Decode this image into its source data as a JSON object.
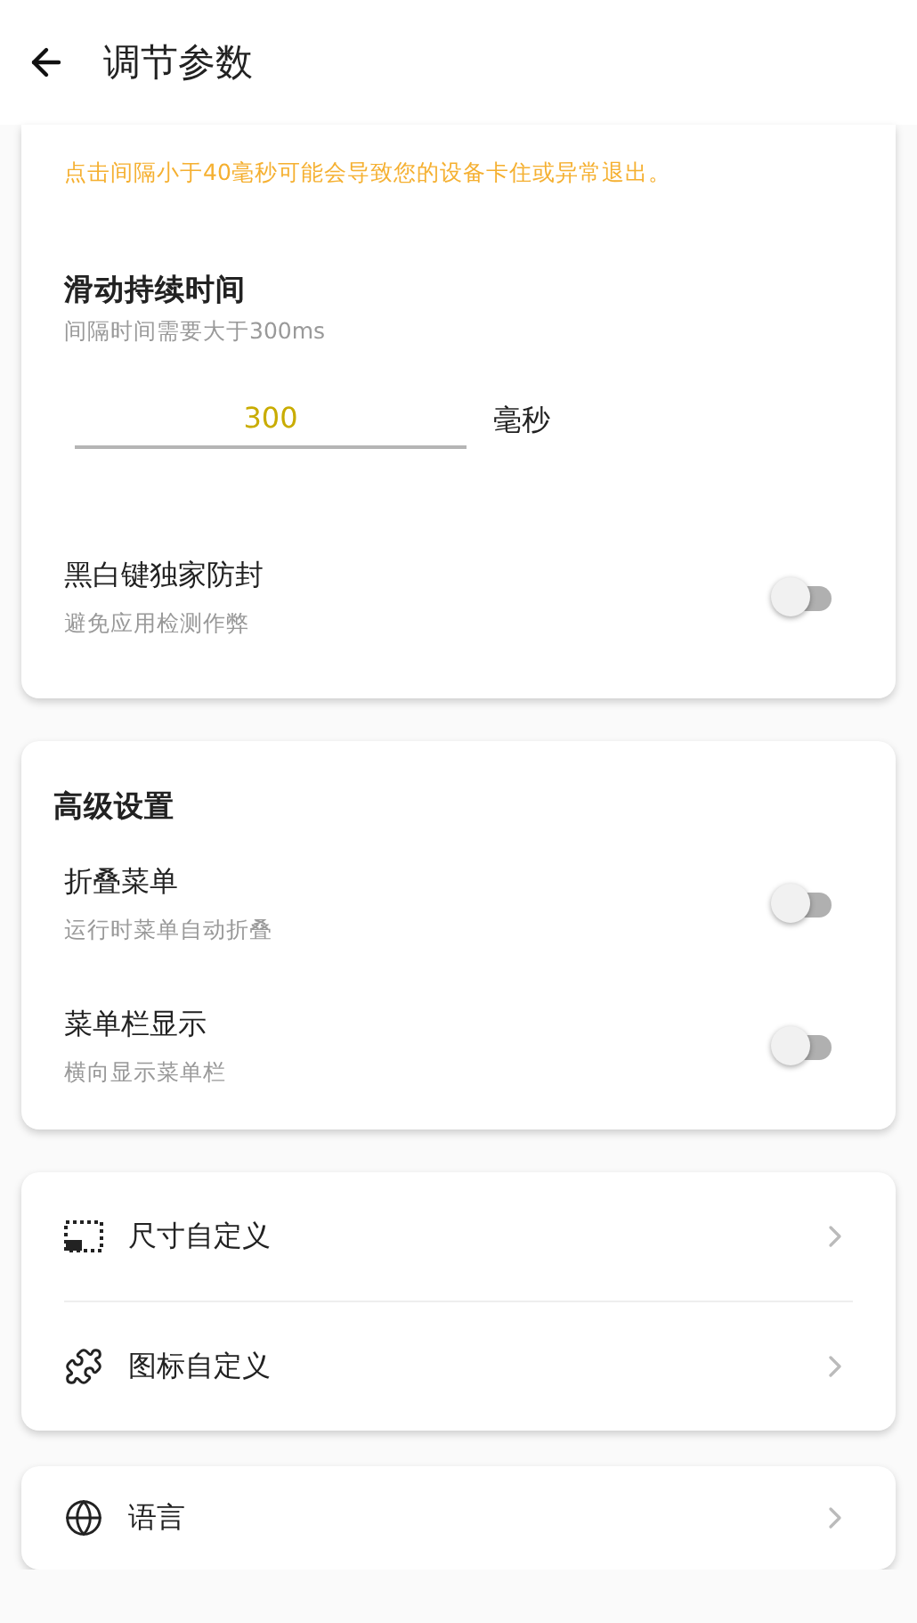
{
  "header": {
    "title": "调节参数"
  },
  "timing_card": {
    "warning": "点击间隔小于40毫秒可能会导致您的设备卡住或异常退出。",
    "section_title": "滑动持续时间",
    "hint": "间隔时间需要大于300ms",
    "input": {
      "value": "300",
      "unit": "毫秒"
    },
    "toggles": [
      {
        "label": "黑白键独家防封",
        "description": "避免应用检测作弊",
        "on": false
      }
    ]
  },
  "advanced_card": {
    "title": "高级设置",
    "toggles": [
      {
        "label": "折叠菜单",
        "description": "运行时菜单自动折叠",
        "on": false
      },
      {
        "label": "菜单栏显示",
        "description": "横向显示菜单栏",
        "on": false
      }
    ]
  },
  "nav_groups": [
    {
      "items": [
        {
          "label": "尺寸自定义"
        },
        {
          "label": "图标自定义"
        }
      ]
    },
    {
      "items": [
        {
          "label": "语言"
        }
      ]
    }
  ]
}
